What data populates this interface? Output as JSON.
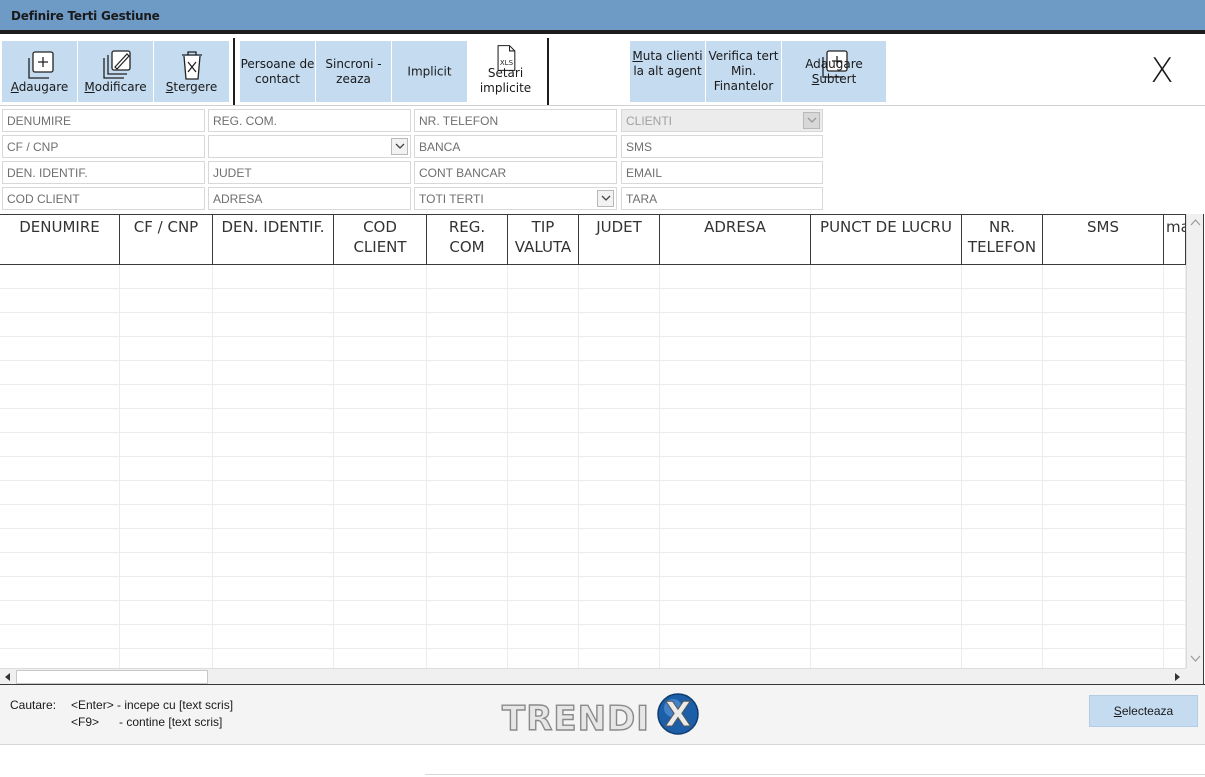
{
  "window": {
    "title": "Definire Terti Gestiune"
  },
  "toolbar": {
    "add": {
      "label_first": "A",
      "label_rest": "daugare"
    },
    "edit": {
      "label_first": "M",
      "label_rest": "odificare"
    },
    "delete": {
      "label_first": "S",
      "label_rest": "tergere"
    },
    "contacts": {
      "line1": "Persoane de",
      "line2": "contact"
    },
    "sync": {
      "line1": "Sincroni -",
      "line2": "zeaza"
    },
    "implicit": {
      "label": "Implicit"
    },
    "xls_settings": {
      "icon_text": "XLS",
      "line1": "Setari",
      "line2": "implicite"
    },
    "move_clients": {
      "line1_first": "M",
      "line1_rest": "uta clienti",
      "line2": "la alt agent"
    },
    "verify": {
      "line1": "Verifica tert",
      "line2": "Min.",
      "line3": "Finantelor"
    },
    "add_subtert": {
      "label_a": "Adaugare ",
      "label_u": "S",
      "label_b": "ubtert"
    },
    "close": {
      "label": "X"
    }
  },
  "filters": {
    "denumire": {
      "placeholder": "DENUMIRE"
    },
    "cf_cnp": {
      "placeholder": "CF / CNP"
    },
    "den_identif": {
      "placeholder": "DEN. IDENTIF."
    },
    "cod_client": {
      "placeholder": "COD CLIENT"
    },
    "reg_com": {
      "placeholder": "REG. COM."
    },
    "combo_blank": {
      "value": ""
    },
    "judet": {
      "placeholder": "JUDET"
    },
    "adresa": {
      "placeholder": "ADRESA"
    },
    "nr_telefon": {
      "placeholder": "NR. TELEFON"
    },
    "banca": {
      "placeholder": "BANCA"
    },
    "cont_bancar": {
      "placeholder": "CONT BANCAR"
    },
    "tip_terti": {
      "value": "TOTI TERTI"
    },
    "categorie": {
      "value": "CLIENTI"
    },
    "sms": {
      "placeholder": "SMS"
    },
    "email": {
      "placeholder": "EMAIL"
    },
    "tara": {
      "placeholder": "TARA"
    }
  },
  "grid": {
    "columns": [
      {
        "line1": "DENUMIRE",
        "line2": ""
      },
      {
        "line1": "CF / CNP",
        "line2": ""
      },
      {
        "line1": "DEN. IDENTIF.",
        "line2": ""
      },
      {
        "line1": "COD",
        "line2": "CLIENT"
      },
      {
        "line1": "REG.",
        "line2": "COM"
      },
      {
        "line1": "TIP",
        "line2": "VALUTA"
      },
      {
        "line1": "JUDET",
        "line2": ""
      },
      {
        "line1": "ADRESA",
        "line2": ""
      },
      {
        "line1": "PUNCT DE LUCRU",
        "line2": ""
      },
      {
        "line1": "NR.",
        "line2": "TELEFON"
      },
      {
        "line1": "SMS",
        "line2": ""
      },
      {
        "line1": "ma",
        "line2": ""
      }
    ]
  },
  "footer": {
    "search_label": "Cautare:",
    "hint_enter_key": "<Enter>",
    "hint_enter_text": "- incepe cu [text scris]",
    "hint_f9_key": "<F9>",
    "hint_f9_text": "- contine [text scris]",
    "logo_text": "TRENDI",
    "logo_letter": "X",
    "select_button": {
      "label_first": "S",
      "label_rest": "electeaza"
    }
  },
  "colors": {
    "titlebar": "#6e9ac6",
    "button": "#c4dbf0",
    "border_dark": "#1d1d1d"
  }
}
